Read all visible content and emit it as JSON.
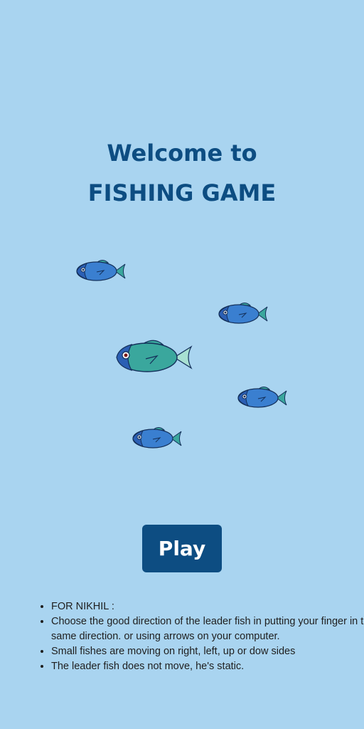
{
  "title": {
    "line1": "Welcome to",
    "line2": "FISHING GAME"
  },
  "colors": {
    "background": "#a9d4f0",
    "title": "#0d4d82",
    "button": "#0d4d82",
    "fish_blue": "#3a7fd0",
    "fish_teal": "#3aa79d"
  },
  "fishes": [
    {
      "name": "small-fish",
      "color": "blue"
    },
    {
      "name": "small-fish",
      "color": "blue"
    },
    {
      "name": "leader-fish",
      "color": "teal"
    },
    {
      "name": "small-fish",
      "color": "blue"
    },
    {
      "name": "small-fish",
      "color": "blue"
    }
  ],
  "play_button": {
    "label": "Play"
  },
  "rules": [
    "FOR NIKHIL :",
    "Choose the good direction of the leader fish in putting your finger in the same direction. or using arrows on your computer.",
    "Small fishes are moving on right, left, up or dow sides",
    "The leader fish does not move, he's static."
  ]
}
